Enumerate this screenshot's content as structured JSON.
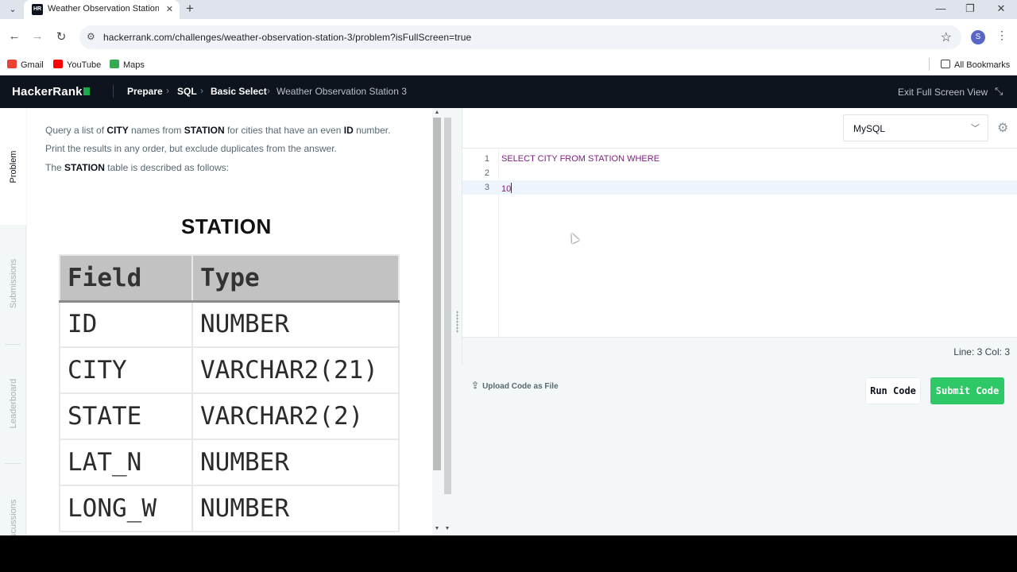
{
  "browser": {
    "tab_title": "Weather Observation Station 3",
    "favicon_text": "HR",
    "url": "hackerrank.com/challenges/weather-observation-station-3/problem?isFullScreen=true",
    "avatar_letter": "S",
    "bookmarks": [
      "Gmail",
      "YouTube",
      "Maps"
    ],
    "all_bookmarks": "All Bookmarks"
  },
  "header": {
    "logo": "HackerRank",
    "breadcrumbs": [
      "Prepare",
      "SQL",
      "Basic Select"
    ],
    "current": "Weather Observation Station 3",
    "exit_fullscreen": "Exit Full Screen View"
  },
  "sidetabs": [
    "Problem",
    "Submissions",
    "Leaderboard",
    "Discussions"
  ],
  "problem": {
    "text1_a": "Query a list of ",
    "text1_b": "CITY",
    "text1_c": " names from ",
    "text1_d": "STATION",
    "text1_e": " for cities that have an even ",
    "text1_f": "ID",
    "text1_g": " number. Print the results in any order, but exclude duplicates from the answer.",
    "text2_a": "The ",
    "text2_b": "STATION",
    "text2_c": " table is described as follows:",
    "table_title": "STATION",
    "table_headers": [
      "Field",
      "Type"
    ],
    "table_rows": [
      [
        "ID",
        "NUMBER"
      ],
      [
        "CITY",
        "VARCHAR2(21)"
      ],
      [
        "STATE",
        "VARCHAR2(2)"
      ],
      [
        "LAT_N",
        "NUMBER"
      ],
      [
        "LONG_W",
        "NUMBER"
      ]
    ]
  },
  "editor": {
    "language": "MySQL",
    "lines": [
      "SELECT CITY FROM STATION WHERE",
      "",
      "10"
    ],
    "line_numbers": [
      "1",
      "2",
      "3"
    ],
    "status": "Line: 3 Col: 3"
  },
  "actions": {
    "upload": "Upload Code as File",
    "run": "Run Code",
    "submit": "Submit Code"
  },
  "colors": {
    "accent_green": "#2ec866",
    "header_bg": "#0e141e"
  }
}
